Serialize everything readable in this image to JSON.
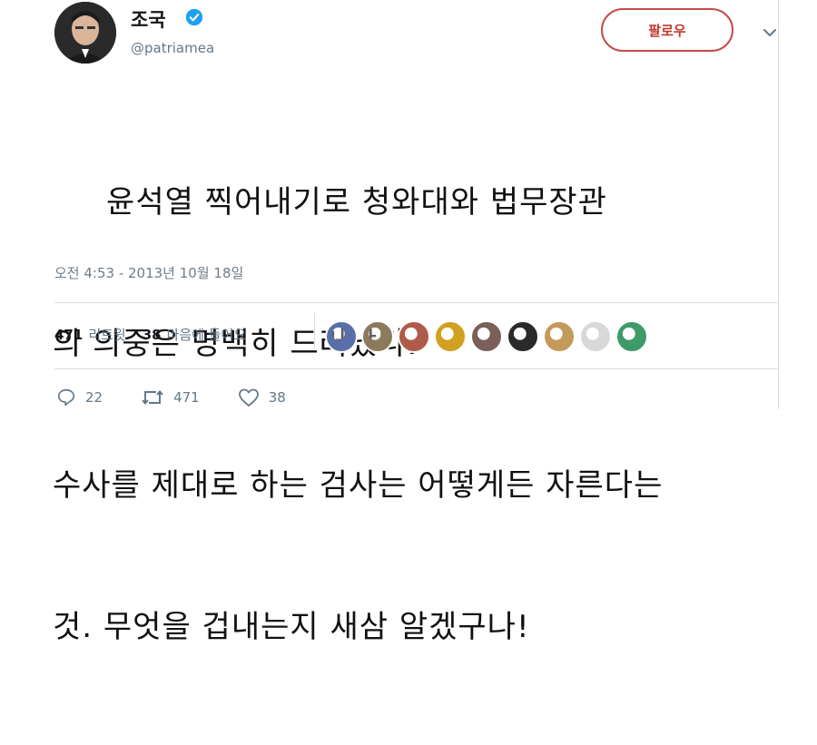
{
  "author": {
    "name": "조국",
    "handle": "@patriamea"
  },
  "follow_button": {
    "label": "팔로우"
  },
  "tweet": {
    "lines": [
      "     윤석열 찍어내기로 청와대와 법무장관",
      "의 의중은 명백히 드러났다.",
      "수사를 제대로 하는 검사는 어떻게든 자른다는",
      "것. 무엇을 겁내는지 새삼 알겠구나!"
    ],
    "timestamp": "오전 4:53 - 2013년 10월 18일"
  },
  "stats": {
    "retweets_count": "471",
    "retweets_label": "리트윗",
    "likes_count": "38",
    "likes_label": "마음에 들어요"
  },
  "liker_avatars": [
    "#5a6fa8",
    "#8c7a5c",
    "#b05a4a",
    "#d1a020",
    "#7a6058",
    "#2a2a2a",
    "#c49a5a",
    "#d8d8d8",
    "#3f9a6a"
  ],
  "actions": {
    "reply_count": "22",
    "retweet_count": "471",
    "like_count": "38"
  },
  "colors": {
    "follow_accent": "#c44b4b",
    "verified": "#1da1f2",
    "muted": "#657786"
  }
}
